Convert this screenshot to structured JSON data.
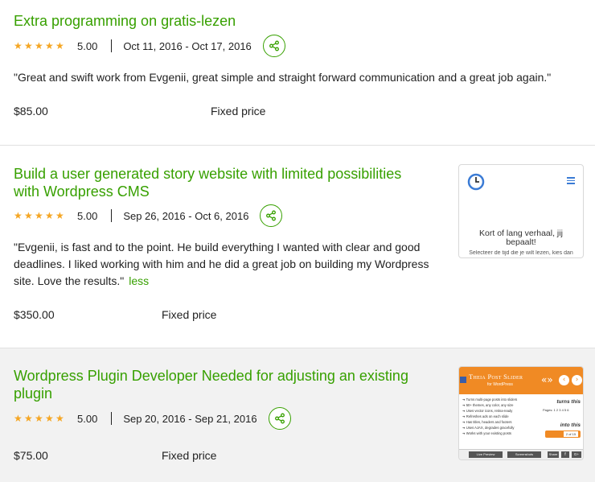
{
  "jobs": [
    {
      "title": "Extra programming on gratis-lezen",
      "rating": "5.00",
      "dates": "Oct 11, 2016 - Oct 17, 2016",
      "feedback": "\"Great and swift work from Evgenii, great simple and straight forward communication and a great job again.\"",
      "price": "$85.00",
      "price_type": "Fixed price"
    },
    {
      "title_line1": "Build a user generated story website with limited possibilities",
      "title_line2": "with Wordpress CMS",
      "rating": "5.00",
      "dates": "Sep 26, 2016 - Oct 6, 2016",
      "feedback_line1": "\"Evgenii, is fast and to the point. He build everything I wanted with clear and good",
      "feedback_line2": "deadlines. I liked working with him and he did a great job on building my Wordpress",
      "feedback_line3": "site. Love the results.\"",
      "less_label": "less",
      "price": "$350.00",
      "price_type": "Fixed price",
      "thumbnail": {
        "heading": "Kort of lang verhaal, jij bepaalt!",
        "subtext": "Selecteer de tijd die je wilt lezen, kies dan",
        "icon": "clock-icon"
      }
    },
    {
      "title_line1": "Wordpress Plugin Developer Needed for adjusting an existing",
      "title_line2": "plugin",
      "rating": "5.00",
      "dates": "Sep 20, 2016 - Sep 21, 2016",
      "price": "$75.00",
      "price_type": "Fixed price",
      "thumbnail": {
        "brand": "Theia Post Slider",
        "brand_sub": "for WordPress",
        "right_text1": "turns this",
        "right_text2": "into this",
        "pages_label": "Pages:",
        "features": [
          "Turns multi-page posts into sliders",
          "50+ themes, any color, any size",
          "Uses vector icons, retina-ready",
          "Refreshes ads on each slide",
          "Has titles, headers and footers",
          "Uses AJAX, degrades gracefully",
          "Works with your existing posts"
        ],
        "btn_preview": "Live Preview",
        "btn_screens": "Screenshots",
        "btn_share": "Share"
      }
    }
  ],
  "colors": {
    "accent": "#37a000",
    "star": "#f5a623",
    "slider_orange": "#f08a24"
  }
}
